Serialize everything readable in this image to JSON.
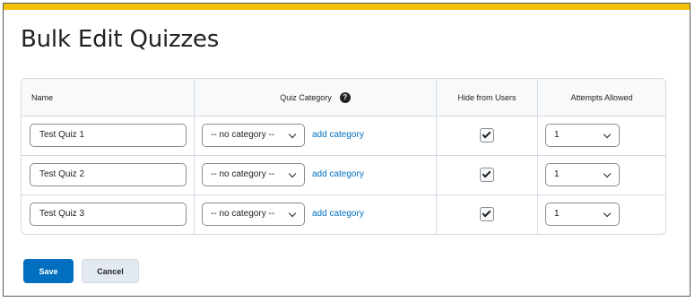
{
  "page": {
    "title": "Bulk Edit Quizzes"
  },
  "colors": {
    "accent_bar": "#f2c200",
    "primary": "#006fbf",
    "link": "#006fbf",
    "border": "#d3d9e3"
  },
  "table": {
    "headers": {
      "name": "Name",
      "category": "Quiz Category",
      "hide": "Hide from Users",
      "attempts": "Attempts Allowed"
    },
    "help_icon": {
      "glyph": "?",
      "icon": "help-icon"
    },
    "rows": [
      {
        "name": "Test Quiz 1",
        "category": "-- no category --",
        "add_category": "add category",
        "hidden": true,
        "attempts": "1"
      },
      {
        "name": "Test Quiz 2",
        "category": "-- no category --",
        "add_category": "add category",
        "hidden": true,
        "attempts": "1"
      },
      {
        "name": "Test Quiz 3",
        "category": "-- no category --",
        "add_category": "add category",
        "hidden": true,
        "attempts": "1"
      }
    ]
  },
  "actions": {
    "save": "Save",
    "cancel": "Cancel"
  }
}
